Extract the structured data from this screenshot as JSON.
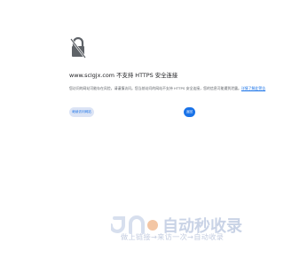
{
  "error": {
    "heading": "www.sclgjx.com 不支持 HTTPS 安全连接",
    "desc_text": "您访问的网站可能存在风险，请谨慎访问。您当前访问的网站不支持 HTTPS 安全连接，您的信息可能遭到泄露。",
    "desc_link": "详情了解此警告",
    "secondary_button": "继续访问网站",
    "primary_button": "返回"
  },
  "watermark": {
    "logo_text": "自动秒收录",
    "tagline": "做上链接→来访一次→自动收录"
  }
}
